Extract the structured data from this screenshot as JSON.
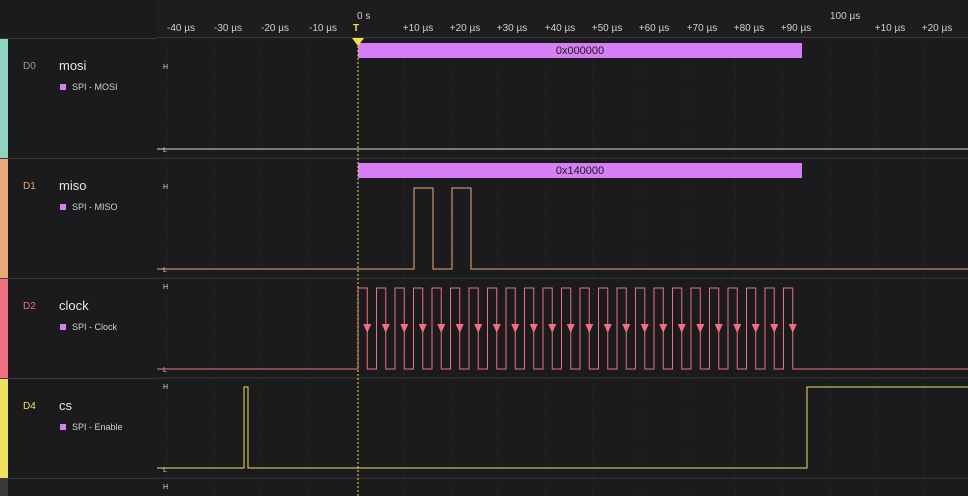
{
  "timeline": {
    "ticks": [
      "-40 µs",
      "-30 µs",
      "-20 µs",
      "-10 µs",
      "+10 µs",
      "+20 µs",
      "+30 µs",
      "+40 µs",
      "+50 µs",
      "+60 µs",
      "+70 µs",
      "+80 µs",
      "+90 µs",
      "+10 µs",
      "+20 µs"
    ],
    "major_labels": [
      "0 s",
      "100 µs"
    ],
    "trigger_label": "T"
  },
  "level_labels": {
    "high": "H",
    "low": "L"
  },
  "channels": [
    {
      "id": "D0",
      "name": "mosi",
      "analyzer": "SPI - MOSI",
      "color": "#8fd4c0",
      "id_color": "#9a9a9a",
      "decoded": "0x000000"
    },
    {
      "id": "D1",
      "name": "miso",
      "analyzer": "SPI - MISO",
      "color": "#e8a878",
      "id_color": "#e8a878",
      "decoded": "0x140000"
    },
    {
      "id": "D2",
      "name": "clock",
      "analyzer": "SPI - Clock",
      "color": "#f07080",
      "id_color": "#f07080",
      "clock_edges": 24
    },
    {
      "id": "D4",
      "name": "cs",
      "analyzer": "SPI - Enable",
      "color": "#f0e060",
      "id_color": "#f0e060"
    }
  ]
}
